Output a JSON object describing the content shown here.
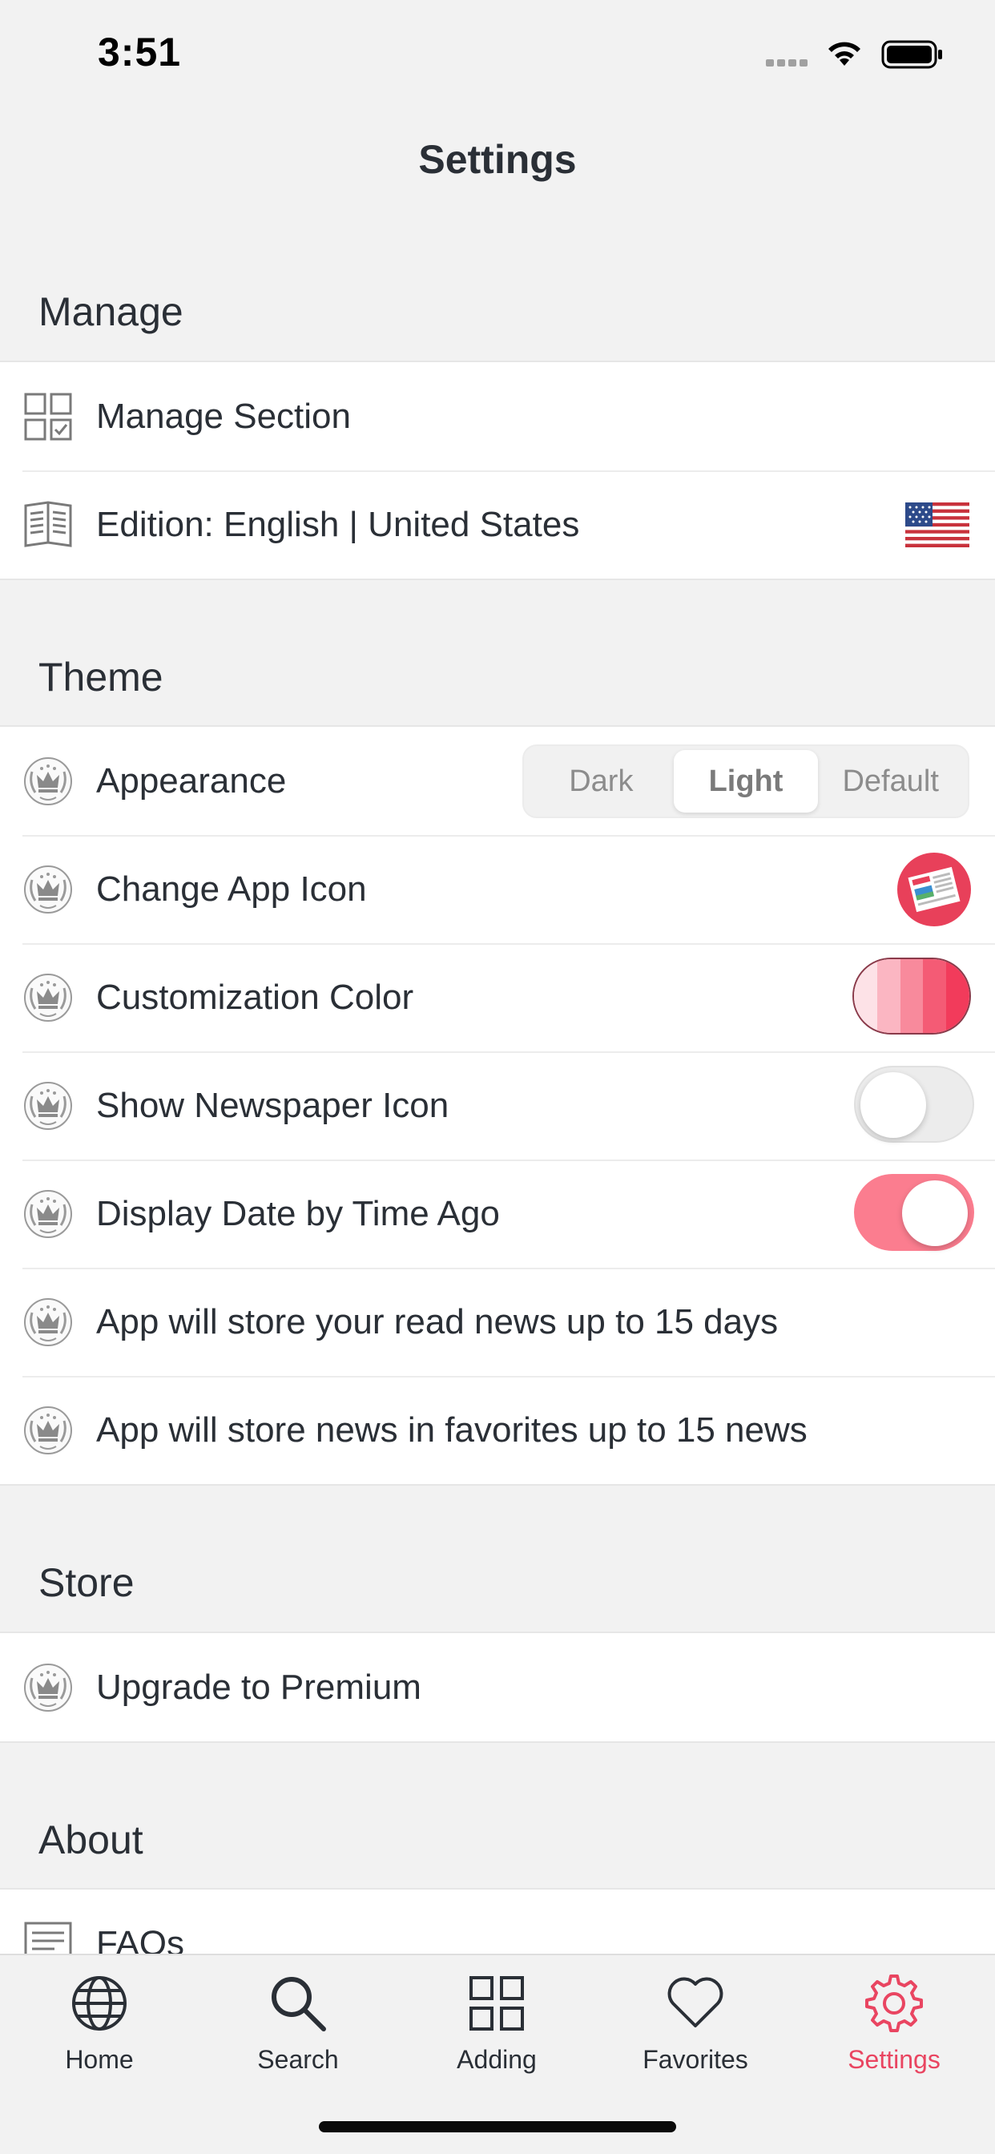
{
  "status": {
    "time": "3:51"
  },
  "nav": {
    "title": "Settings"
  },
  "sections": {
    "manage": {
      "header": "Manage",
      "items": [
        {
          "label": "Manage Section",
          "icon": "grid-check-icon"
        },
        {
          "label": "Edition: English | United States",
          "icon": "book-icon",
          "accessory": "us-flag-icon"
        }
      ]
    },
    "theme": {
      "header": "Theme",
      "appearance": {
        "label": "Appearance",
        "options": [
          "Dark",
          "Light",
          "Default"
        ],
        "selected": "Light"
      },
      "change_icon": {
        "label": "Change App Icon"
      },
      "custom_color": {
        "label": "Customization Color",
        "swatches": [
          "#fde2e7",
          "#fbb6c2",
          "#f88a9c",
          "#f45b75",
          "#f23b5b"
        ]
      },
      "newspaper_icon": {
        "label": "Show Newspaper Icon",
        "on": false
      },
      "time_ago": {
        "label": "Display Date by Time Ago",
        "on": true
      },
      "read_news": {
        "label": "App will store your read news up to 15 days"
      },
      "favorites": {
        "label": "App will store news in favorites up to 15 news"
      }
    },
    "store": {
      "header": "Store",
      "items": [
        {
          "label": "Upgrade to Premium",
          "icon": "premium-crown-icon"
        }
      ]
    },
    "about": {
      "header": "About",
      "items": [
        {
          "label": "FAQs",
          "icon": "faq-icon"
        }
      ]
    }
  },
  "tabs": [
    {
      "label": "Home",
      "icon": "globe-icon"
    },
    {
      "label": "Search",
      "icon": "search-icon"
    },
    {
      "label": "Adding",
      "icon": "grid-icon"
    },
    {
      "label": "Favorites",
      "icon": "heart-icon"
    },
    {
      "label": "Settings",
      "icon": "gear-icon",
      "active": true
    }
  ],
  "colors": {
    "accent": "#e94561",
    "toggle_on": "#fb7d8f"
  }
}
